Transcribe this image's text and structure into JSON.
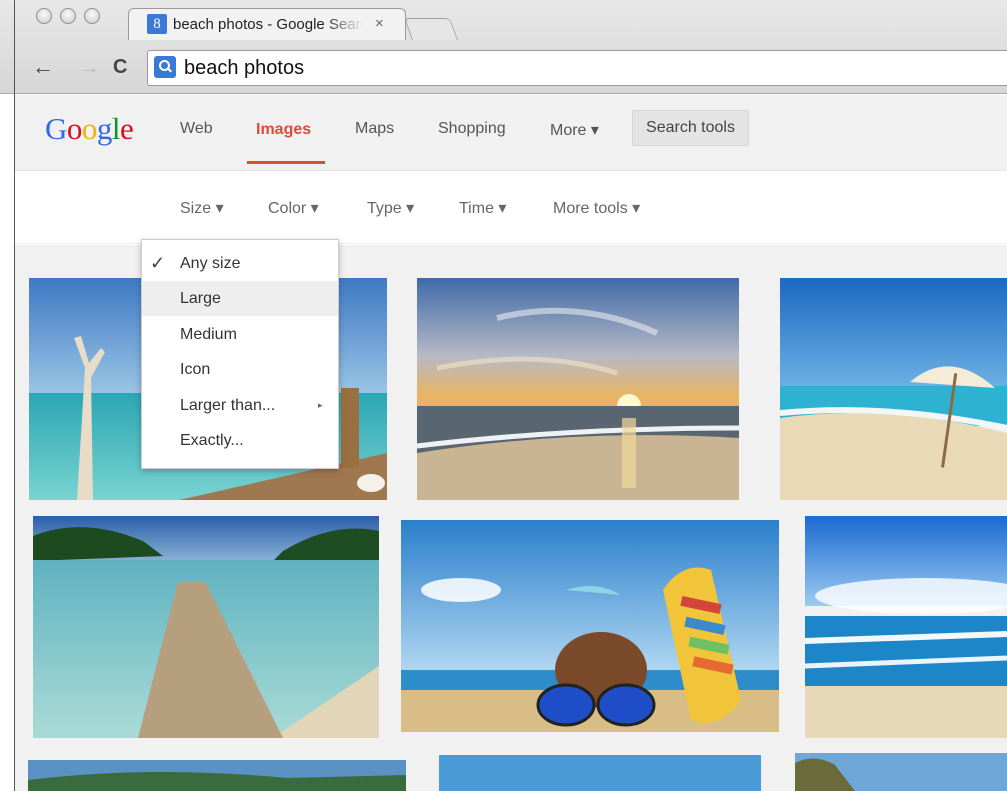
{
  "browser": {
    "tab_title": "beach photos - Google Search",
    "tab_close": "×",
    "tab_favicon": "8",
    "address": "beach photos",
    "back_glyph": "←",
    "forward_glyph": "→",
    "reload_glyph": "C"
  },
  "google": {
    "logo_letters": [
      "G",
      "o",
      "o",
      "g",
      "l",
      "e"
    ],
    "logo_colors": [
      "#3369e8",
      "#d50f25",
      "#eeb211",
      "#3369e8",
      "#009925",
      "#d50f25"
    ],
    "nav": {
      "web": "Web",
      "images": "Images",
      "maps": "Maps",
      "shopping": "Shopping",
      "more": "More ▾"
    },
    "search_tools": "Search tools",
    "active_color": "#dd4b39"
  },
  "tools": {
    "size": "Size ▾",
    "color": "Color ▾",
    "type": "Type ▾",
    "time": "Time ▾",
    "more_tools": "More tools ▾"
  },
  "size_menu": {
    "check": "✓",
    "submenu_arrow": "▸",
    "items": [
      "Any size",
      "Large",
      "Medium",
      "Icon",
      "Larger than...",
      "Exactly..."
    ],
    "selected": "Any size",
    "highlighted": "Large"
  },
  "results": {
    "thumbnails": [
      "beach-pier-dead-tree",
      "sunset-beach-waves",
      "beach-umbrella",
      "wooden-jetty-lagoon",
      "coconut-flipflops-sunglasses",
      "blue-sea-waves",
      "beach-partial-1",
      "beach-partial-2",
      "beach-partial-3"
    ]
  }
}
